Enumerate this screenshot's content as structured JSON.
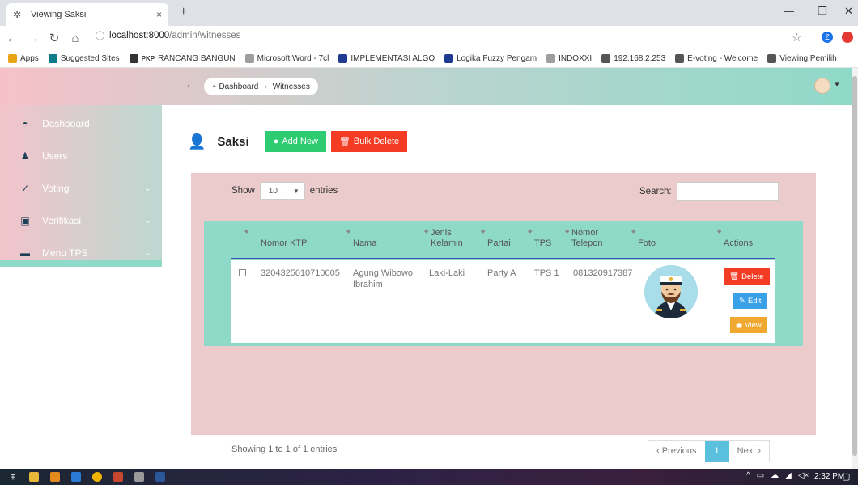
{
  "browser": {
    "tab_title": "Viewing Saksi",
    "tab_close": "×",
    "new_tab": "+",
    "url_host": "localhost:8000",
    "url_path": "/admin/witnesses",
    "profile_letter": "Z",
    "bookmarks": [
      {
        "label": "Apps",
        "icon": "apps-grid-icon",
        "color": "#e8a317"
      },
      {
        "label": "Suggested Sites",
        "icon": "bing-icon",
        "color": "#0f7b8a"
      },
      {
        "label": "RANCANG BANGUN",
        "icon": "pkp-icon",
        "color": "#333333",
        "prefix": "PKP"
      },
      {
        "label": "Microsoft Word - 7cl",
        "icon": "document-icon",
        "color": "#9e9e9e"
      },
      {
        "label": "IMPLEMENTASI ALGO",
        "icon": "d-icon",
        "color": "#1f3a93"
      },
      {
        "label": "Logika Fuzzy Pengam",
        "icon": "d-icon",
        "color": "#1f3a93"
      },
      {
        "label": "INDOXXI",
        "icon": "document-icon",
        "color": "#9e9e9e"
      },
      {
        "label": "192.168.2.253",
        "icon": "globe-icon",
        "color": "#555555"
      },
      {
        "label": "E-voting - Welcome",
        "icon": "laravel-icon",
        "color": "#555555"
      },
      {
        "label": "Viewing Pemilih",
        "icon": "laravel-icon",
        "color": "#555555"
      }
    ]
  },
  "breadcrumb": {
    "home": "Dashboard",
    "current": "Witnesses"
  },
  "sidebar": {
    "items": [
      {
        "label": "Dashboard",
        "icon": "dashboard-icon",
        "has_caret": false
      },
      {
        "label": "Users",
        "icon": "user-icon",
        "has_caret": false
      },
      {
        "label": "Voting",
        "icon": "check-icon",
        "has_caret": true
      },
      {
        "label": "Verifikasi",
        "icon": "verify-icon",
        "has_caret": true
      },
      {
        "label": "Menu TPS",
        "icon": "folder-icon",
        "has_caret": true
      }
    ]
  },
  "page": {
    "title": "Saksi",
    "add_label": "Add New",
    "bulk_label": "Bulk Delete",
    "colors": {
      "add": "#2ecc71",
      "bulk": "#f43c25"
    }
  },
  "table": {
    "show_label": "Show",
    "entries_label": "entries",
    "page_length": "10",
    "search_label": "Search:",
    "columns": [
      {
        "line1": "",
        "line2": "Nomor KTP"
      },
      {
        "line1": "",
        "line2": "Nama"
      },
      {
        "line1": "Jenis",
        "line2": "Kelamin"
      },
      {
        "line1": "",
        "line2": "Partai"
      },
      {
        "line1": "",
        "line2": "TPS"
      },
      {
        "line1": "Nomor",
        "line2": "Telepon"
      },
      {
        "line1": "",
        "line2": "Foto"
      },
      {
        "line1": "",
        "line2": "Actions"
      }
    ],
    "rows": [
      {
        "ktp": "3204325010710005",
        "nama_line1": "Agung Wibowo",
        "nama_line2": "Ibrahim",
        "kelamin": "Laki-Laki",
        "partai": "Party A",
        "tps": "TPS 1",
        "telepon": "081320917387",
        "foto": "captain-avatar",
        "actions": {
          "delete": "Delete",
          "edit": "Edit",
          "view": "View"
        }
      }
    ],
    "action_colors": {
      "delete": "#f43c25",
      "edit": "#3aa0e8",
      "view": "#f0a830"
    },
    "info": "Showing 1 to 1 of 1 entries",
    "pager": {
      "previous": "‹ Previous",
      "current": "1",
      "next": "Next ›"
    }
  },
  "taskbar": {
    "clock": "2:32 PM"
  }
}
